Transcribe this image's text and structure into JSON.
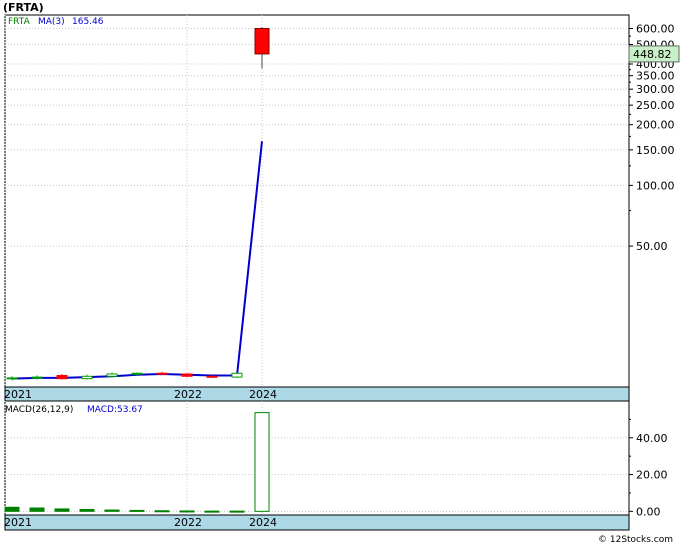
{
  "title": "(FRTA)",
  "watermark": "© 12Stocks.com",
  "colors": {
    "grid": "#c8c8c8",
    "axis_band": "#add8e6",
    "up": "#00a000",
    "down": "#ff0000",
    "ma_line": "#0000cc",
    "price_label_bg": "#c8f0c8",
    "macd_bar": "#008000"
  },
  "chart_data": [
    {
      "type": "candlestick",
      "title": "(FRTA)",
      "scale": "log",
      "ylim": [
        10,
        700
      ],
      "y_ticks": [
        600,
        500,
        400,
        350,
        300,
        250,
        200,
        150,
        100,
        50
      ],
      "y_tick_labels": [
        "600.00",
        "500.00",
        "400.00",
        "350.00",
        "300.00",
        "250.00",
        "200.00",
        "150.00",
        "100.00",
        "50.00"
      ],
      "x_ticks": [
        {
          "index": 0,
          "label": "2021"
        },
        {
          "index": 7,
          "label": "2022"
        },
        {
          "index": 10,
          "label": "2024"
        }
      ],
      "last_price": 448.82,
      "last_price_label": "448.82",
      "legend": {
        "symbol": "FRTA",
        "ma_label": "MA(3)",
        "ma_value": "165.46"
      },
      "candles": [
        {
          "o": 11.0,
          "h": 11.3,
          "l": 10.8,
          "c": 11.1
        },
        {
          "o": 11.1,
          "h": 11.4,
          "l": 10.9,
          "c": 11.2
        },
        {
          "o": 11.4,
          "h": 11.6,
          "l": 10.9,
          "c": 11.0
        },
        {
          "o": 11.0,
          "h": 11.5,
          "l": 10.9,
          "c": 11.3
        },
        {
          "o": 11.3,
          "h": 11.8,
          "l": 11.2,
          "c": 11.6
        },
        {
          "o": 11.6,
          "h": 11.8,
          "l": 11.4,
          "c": 11.7
        },
        {
          "o": 11.7,
          "h": 11.9,
          "l": 11.5,
          "c": 11.6
        },
        {
          "o": 11.6,
          "h": 11.7,
          "l": 11.2,
          "c": 11.3
        },
        {
          "o": 11.3,
          "h": 11.4,
          "l": 11.1,
          "c": 11.2
        },
        {
          "o": 11.2,
          "h": 11.8,
          "l": 11.1,
          "c": 11.7
        },
        {
          "o": 600.0,
          "h": 610.0,
          "l": 380.0,
          "c": 448.82
        }
      ],
      "ma": [
        11.0,
        11.1,
        11.1,
        11.2,
        11.3,
        11.5,
        11.6,
        11.5,
        11.4,
        11.4,
        165.46
      ]
    },
    {
      "type": "bar",
      "title": "MACD",
      "ylim": [
        -2,
        60
      ],
      "y_ticks": [
        40,
        20,
        0
      ],
      "y_tick_labels": [
        "40.00",
        "20.00",
        "0.00"
      ],
      "x_ticks": [
        {
          "index": 0,
          "label": "2021"
        },
        {
          "index": 7,
          "label": "2022"
        },
        {
          "index": 10,
          "label": "2024"
        }
      ],
      "legend": {
        "params": "MACD(26,12,9)",
        "value_label": "MACD:53.67"
      },
      "values": [
        2.2,
        1.8,
        1.3,
        1.0,
        0.7,
        0.5,
        0.3,
        0.2,
        0.1,
        0.1,
        53.67
      ]
    }
  ]
}
